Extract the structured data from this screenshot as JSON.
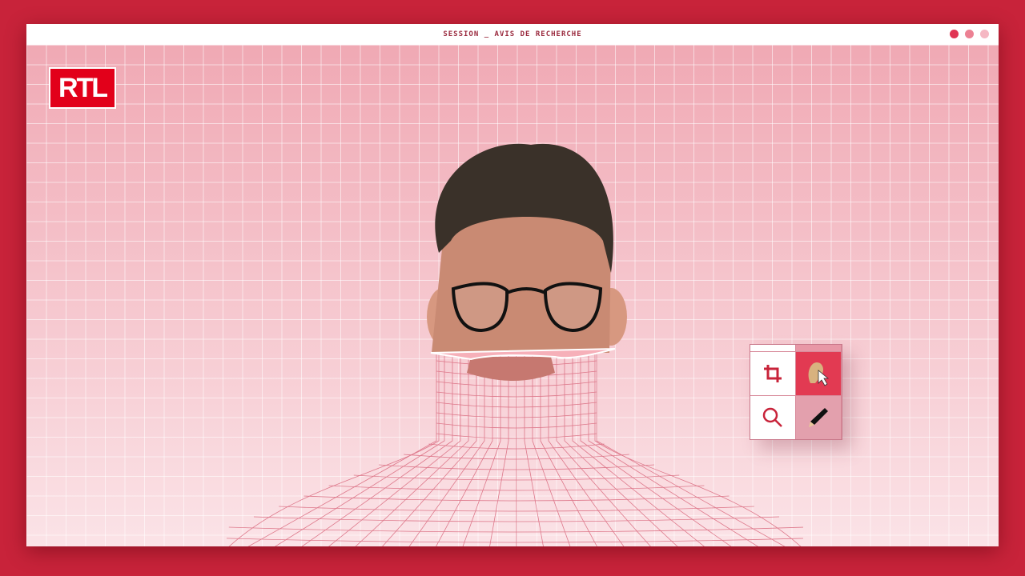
{
  "window": {
    "title": "SESSION _ AVIS DE RECHERCHE",
    "dot_colors": [
      "#e03553",
      "#ec8193",
      "#f5b8c3"
    ]
  },
  "logo": {
    "text": "RTL"
  },
  "toolbox": {
    "tools": [
      "crop-tool",
      "hair-tool",
      "zoom-tool",
      "pencil-tool"
    ],
    "active": "hair-tool"
  },
  "colors": {
    "accent": "#e23a52",
    "frame": "#c8233a"
  }
}
